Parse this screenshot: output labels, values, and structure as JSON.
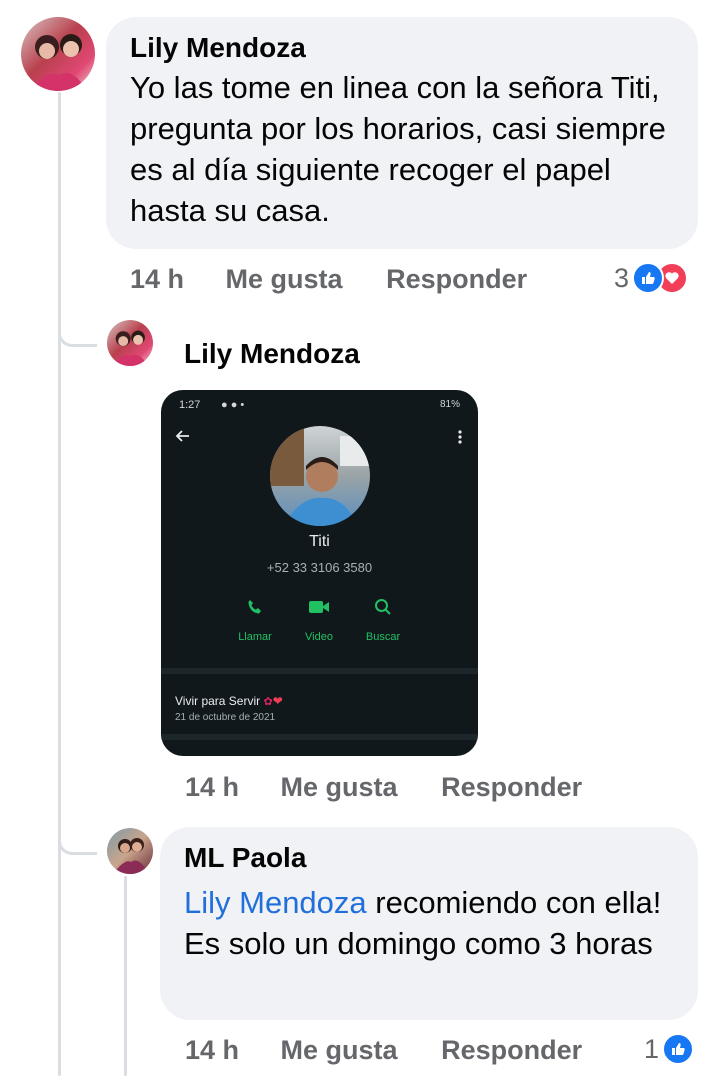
{
  "comment1": {
    "author": "Lily Mendoza",
    "text": "Yo las tome en linea con la señora Titi, pregunta por los horarios, casi siempre es al día siguiente recoger el papel hasta su casa.",
    "time": "14 h",
    "like": "Me gusta",
    "reply": "Responder",
    "reaction_count": "3"
  },
  "reply1": {
    "author": "Lily Mendoza",
    "time": "14 h",
    "like": "Me gusta",
    "reply": "Responder",
    "attachment": {
      "status_time": "1:27",
      "status_battery": "81%",
      "contact_name": "Titi",
      "contact_phone": "+52 33 3106 3580",
      "actions": [
        "Llamar",
        "Video",
        "Buscar"
      ],
      "about_text": "Vivir para Servir",
      "about_date": "21 de octubre de 2021"
    }
  },
  "reply2": {
    "author": "ML Paola",
    "mention": "Lily Mendoza",
    "text": " recomiendo con ella! Es solo un domingo como 3 horas",
    "time": "14 h",
    "like": "Me gusta",
    "reply": "Responder",
    "reaction_count": "1"
  },
  "colors": {
    "like_blue": "#1877f2",
    "love_red": "#f33e58",
    "mention_blue": "#216fdb",
    "whatsapp_green": "#21c063"
  },
  "icons": [
    "like-icon",
    "love-icon",
    "back-arrow-icon",
    "more-vert-icon",
    "phone-icon",
    "video-icon",
    "search-icon"
  ]
}
